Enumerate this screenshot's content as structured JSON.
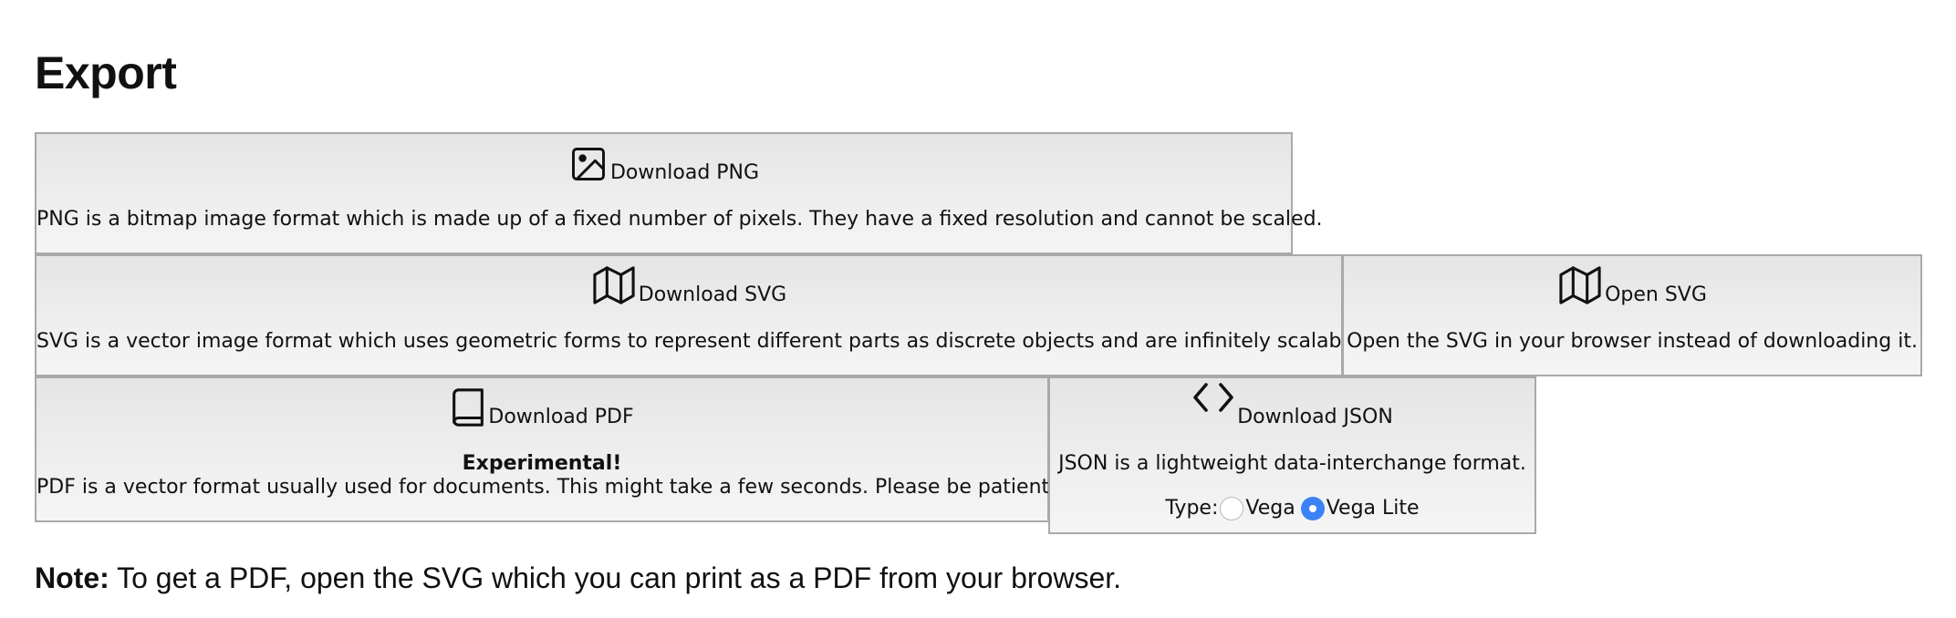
{
  "page": {
    "title": "Export"
  },
  "export_options": {
    "png": {
      "icon": "image-icon",
      "label": "Download PNG",
      "description": "PNG is a bitmap image format which is made up of a fixed number of pixels. They have a fixed resolution and cannot be scaled."
    },
    "svg": {
      "icon": "map-icon",
      "label": "Download SVG",
      "description": "SVG is a vector image format which uses geometric forms to represent different parts as discrete objects and are infinitely scalable."
    },
    "open_svg": {
      "icon": "map-icon",
      "label": "Open SVG",
      "description": "Open the SVG in your browser instead of downloading it."
    },
    "pdf": {
      "icon": "book-icon",
      "label": "Download PDF",
      "warning": "Experimental!",
      "description": "PDF is a vector format usually used for documents. This might take a few seconds. Please be patient."
    },
    "json": {
      "icon": "code-icon",
      "label": "Download JSON",
      "description": "JSON is a lightweight data-interchange format.",
      "type_label": "Type:",
      "type_options": [
        {
          "label": "Vega",
          "selected": false
        },
        {
          "label": "Vega Lite",
          "selected": true
        }
      ]
    }
  },
  "note": {
    "prefix": "Note:",
    "text": " To get a PDF, open the SVG which you can print as a PDF from your browser."
  },
  "colors": {
    "card_border": "#a9a9a9",
    "card_gradient_top": "#e5e5e5",
    "card_gradient_bottom": "#f5f5f5",
    "radio_selected": "#3b82f6"
  }
}
